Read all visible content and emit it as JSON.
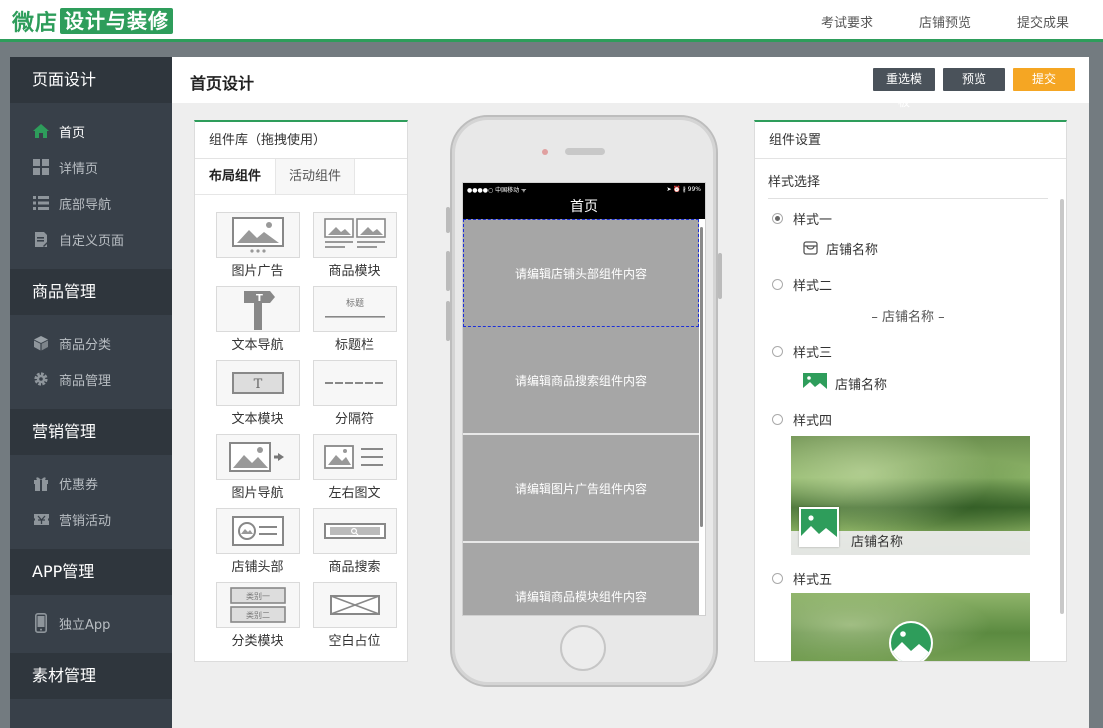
{
  "header": {
    "logo_left": "微店",
    "logo_box": "设计与装修",
    "nav": [
      "考试要求",
      "店铺预览",
      "提交成果"
    ]
  },
  "sidebar": {
    "sections": [
      {
        "title": "页面设计",
        "items": [
          {
            "label": "首页",
            "icon": "home-icon",
            "active": true
          },
          {
            "label": "详情页",
            "icon": "grid-icon",
            "active": false
          },
          {
            "label": "底部导航",
            "icon": "list-icon",
            "active": false
          },
          {
            "label": "自定义页面",
            "icon": "edit-page-icon",
            "active": false
          }
        ]
      },
      {
        "title": "商品管理",
        "items": [
          {
            "label": "商品分类",
            "icon": "cube-icon"
          },
          {
            "label": "商品管理",
            "icon": "gear-icon"
          }
        ]
      },
      {
        "title": "营销管理",
        "items": [
          {
            "label": "优惠券",
            "icon": "gift-icon"
          },
          {
            "label": "营销活动",
            "icon": "ticket-icon"
          }
        ]
      },
      {
        "title": "APP管理",
        "items": [
          {
            "label": "独立App",
            "icon": "phone-icon"
          }
        ]
      },
      {
        "title": "素材管理",
        "items": []
      }
    ]
  },
  "page": {
    "title": "首页设计",
    "buttons": {
      "reselect": "重选模板",
      "preview": "预览",
      "submit": "提交"
    }
  },
  "components": {
    "title": "组件库（拖拽使用）",
    "tabs": [
      "布局组件",
      "活动组件"
    ],
    "items": [
      "图片广告",
      "商品模块",
      "文本导航",
      "标题栏",
      "文本模块",
      "分隔符",
      "图片导航",
      "左右图文",
      "店铺头部",
      "商品搜索",
      "分类模块",
      "空白占位"
    ],
    "thumb_text": {
      "title_bar": "标题",
      "cat1": "类别一",
      "cat2": "类别二"
    }
  },
  "phone": {
    "status_left": "●●●●○ 中国移动 ᯤ",
    "status_right": "➤ ⏰ ∦ 99%",
    "nav_title": "首页",
    "blocks": [
      "请编辑店铺头部组件内容",
      "请编辑商品搜索组件内容",
      "请编辑图片广告组件内容",
      "请编辑商品模块组件内容"
    ]
  },
  "settings": {
    "title": "组件设置",
    "section": "样式选择",
    "styles": [
      "样式一",
      "样式二",
      "样式三",
      "样式四",
      "样式五"
    ],
    "selected": 0,
    "store_name": "店铺名称",
    "store_name_style2": "– 店铺名称 –"
  },
  "colors": {
    "brand_green": "#2e9d5b",
    "submit_orange": "#f5a623",
    "sidebar_bg": "#384049"
  }
}
